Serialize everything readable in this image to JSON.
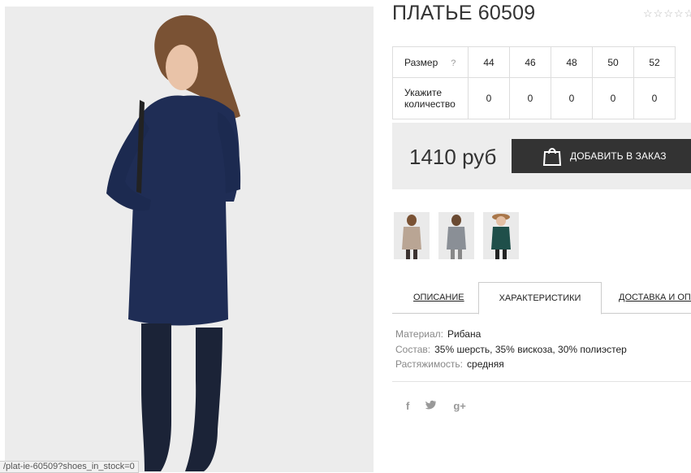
{
  "product": {
    "title": "ПЛАТЬЕ 60509",
    "rating_stars": [
      "☆",
      "☆",
      "☆",
      "☆",
      "☆"
    ],
    "price": "1410 руб",
    "order_button": "ДОБАВИТЬ В ЗАКАЗ",
    "image_icon": "dress-model-photo"
  },
  "sizes": {
    "size_label": "Размер",
    "help_glyph": "?",
    "qty_label": "Укажите количество",
    "sizes": [
      "44",
      "46",
      "48",
      "50",
      "52"
    ],
    "quantities": [
      "0",
      "0",
      "0",
      "0",
      "0"
    ]
  },
  "thumbnails": [
    {
      "name": "thumb-beige",
      "color": "#b9a594"
    },
    {
      "name": "thumb-grey",
      "color": "#8a8f96"
    },
    {
      "name": "thumb-green",
      "color": "#1f4f4a"
    }
  ],
  "tabs": [
    {
      "label": "ОПИСАНИЕ",
      "active": false
    },
    {
      "label": "ХАРАКТЕРИСТИКИ",
      "active": true
    },
    {
      "label": "ДОСТАВКА И ОПЛ",
      "active": false
    }
  ],
  "characteristics": [
    {
      "key": "Материал:",
      "value": "Рибана"
    },
    {
      "key": "Состав:",
      "value": "35% шерсть, 35% вискоза, 30% полиэстер"
    },
    {
      "key": "Растяжимость:",
      "value": "средняя"
    }
  ],
  "social": [
    {
      "icon": "facebook-icon",
      "glyph": "f"
    },
    {
      "icon": "twitter-icon",
      "glyph": "🐦"
    },
    {
      "icon": "google-plus-icon",
      "glyph": "g+"
    }
  ],
  "status_bar": {
    "url": "/plat-ie-60509?shoes_in_stock=0"
  },
  "colors": {
    "dress": "#1f2d55",
    "button": "#333333",
    "price_box": "#ededed"
  }
}
